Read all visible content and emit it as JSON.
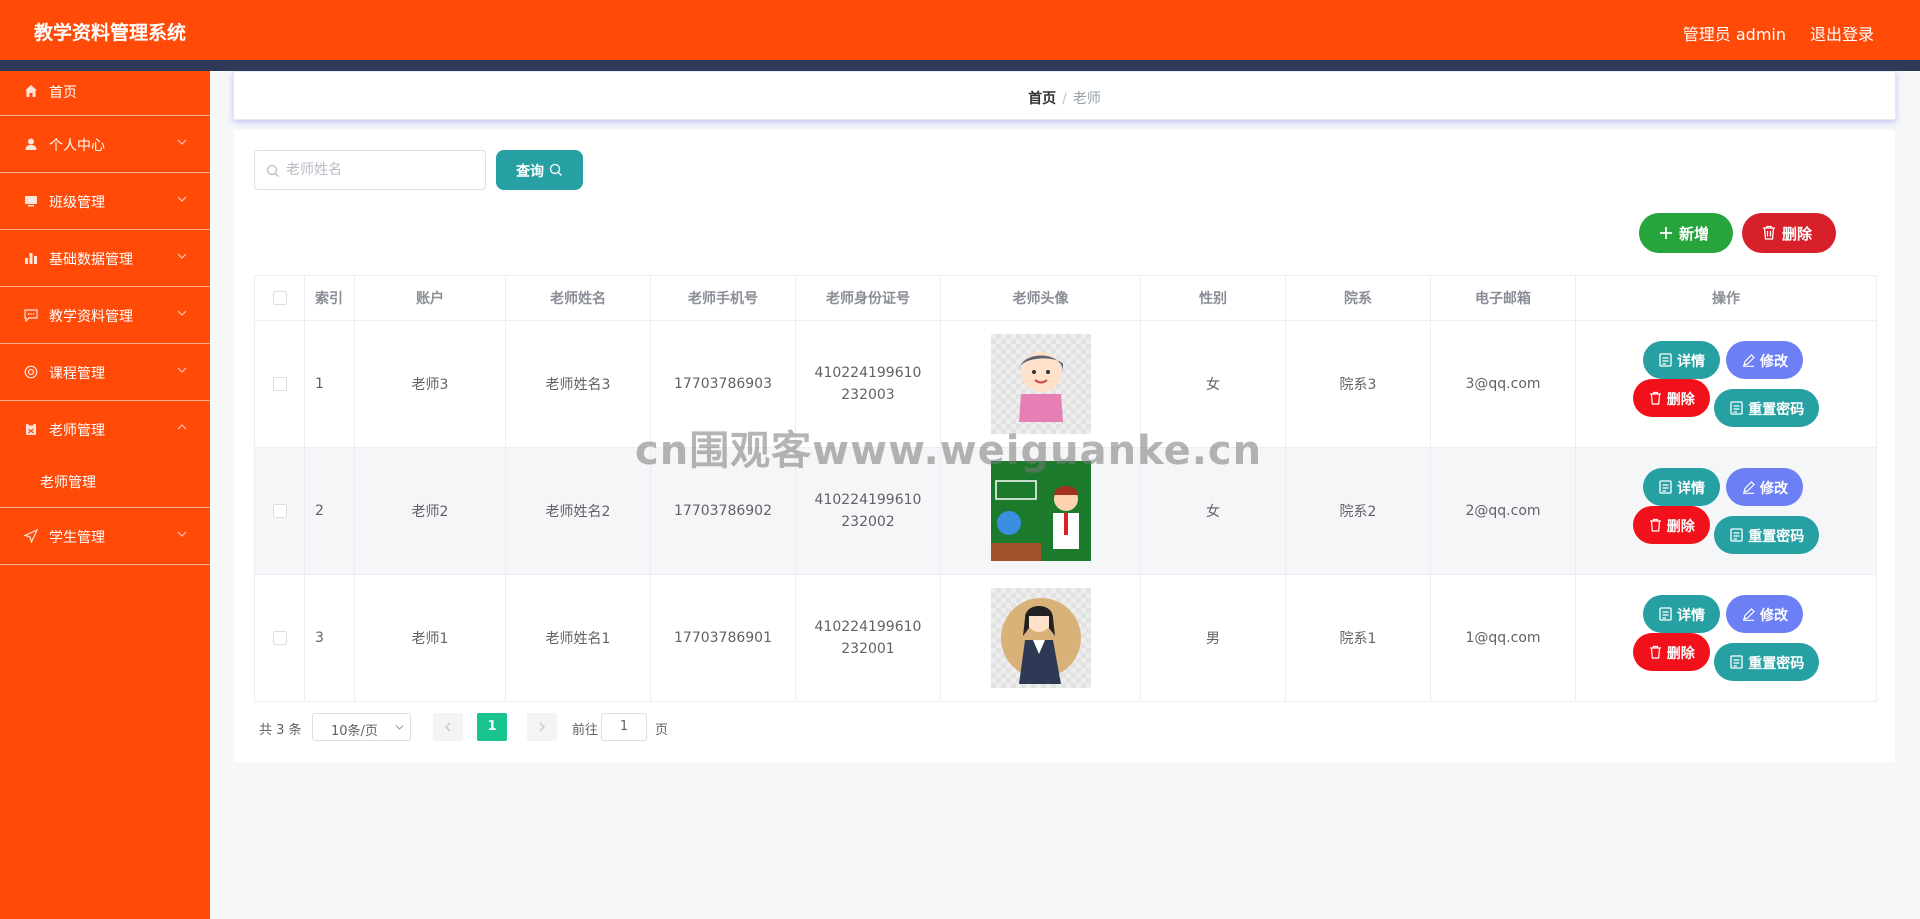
{
  "header": {
    "app_title": "教学资料管理系统",
    "user_label": "管理员 admin",
    "logout_label": "退出登录"
  },
  "sidebar": {
    "items": [
      {
        "label": "首页",
        "icon": "home-icon"
      },
      {
        "label": "个人中心",
        "icon": "user-icon"
      },
      {
        "label": "班级管理",
        "icon": "monitor-icon"
      },
      {
        "label": "基础数据管理",
        "icon": "bar-chart-icon"
      },
      {
        "label": "教学资料管理",
        "icon": "chat-icon"
      },
      {
        "label": "课程管理",
        "icon": "lifebuoy-icon"
      },
      {
        "label": "老师管理",
        "icon": "clipboard-icon",
        "expanded": true,
        "children": [
          {
            "label": "老师管理"
          }
        ]
      },
      {
        "label": "学生管理",
        "icon": "send-icon"
      }
    ]
  },
  "breadcrumb": {
    "home": "首页",
    "separator": "/",
    "current": "老师"
  },
  "search": {
    "placeholder": "老师姓名",
    "value": "",
    "query_label": "查询"
  },
  "actions": {
    "add_label": "新增",
    "delete_label": "删除"
  },
  "table": {
    "columns": [
      "索引",
      "账户",
      "老师姓名",
      "老师手机号",
      "老师身份证号",
      "老师头像",
      "性别",
      "院系",
      "电子邮箱",
      "操作"
    ],
    "rows": [
      {
        "index": "1",
        "account": "老师3",
        "name": "老师姓名3",
        "phone": "17703786903",
        "idcard": "410224199610232003",
        "gender": "女",
        "dept": "院系3",
        "email": "3@qq.com"
      },
      {
        "index": "2",
        "account": "老师2",
        "name": "老师姓名2",
        "phone": "17703786902",
        "idcard": "410224199610232002",
        "gender": "女",
        "dept": "院系2",
        "email": "2@qq.com"
      },
      {
        "index": "3",
        "account": "老师1",
        "name": "老师姓名1",
        "phone": "17703786901",
        "idcard": "410224199610232001",
        "gender": "男",
        "dept": "院系1",
        "email": "1@qq.com"
      }
    ],
    "row_actions": {
      "detail": "详情",
      "edit": "修改",
      "delete": "删除",
      "reset": "重置密码"
    }
  },
  "pagination": {
    "total_text": "共 3 条",
    "page_size": "10条/页",
    "current_page": "1",
    "goto_label": "前往",
    "goto_value": "1",
    "page_unit": "页"
  },
  "watermark": "cn围观客www.weiguanke.cn",
  "colors": {
    "primary": "#ff4a08",
    "teal": "#27a0a3",
    "green": "#27a43c",
    "red": "#d8202a",
    "purple": "#6c7ff5",
    "page_active": "#19c48e"
  }
}
